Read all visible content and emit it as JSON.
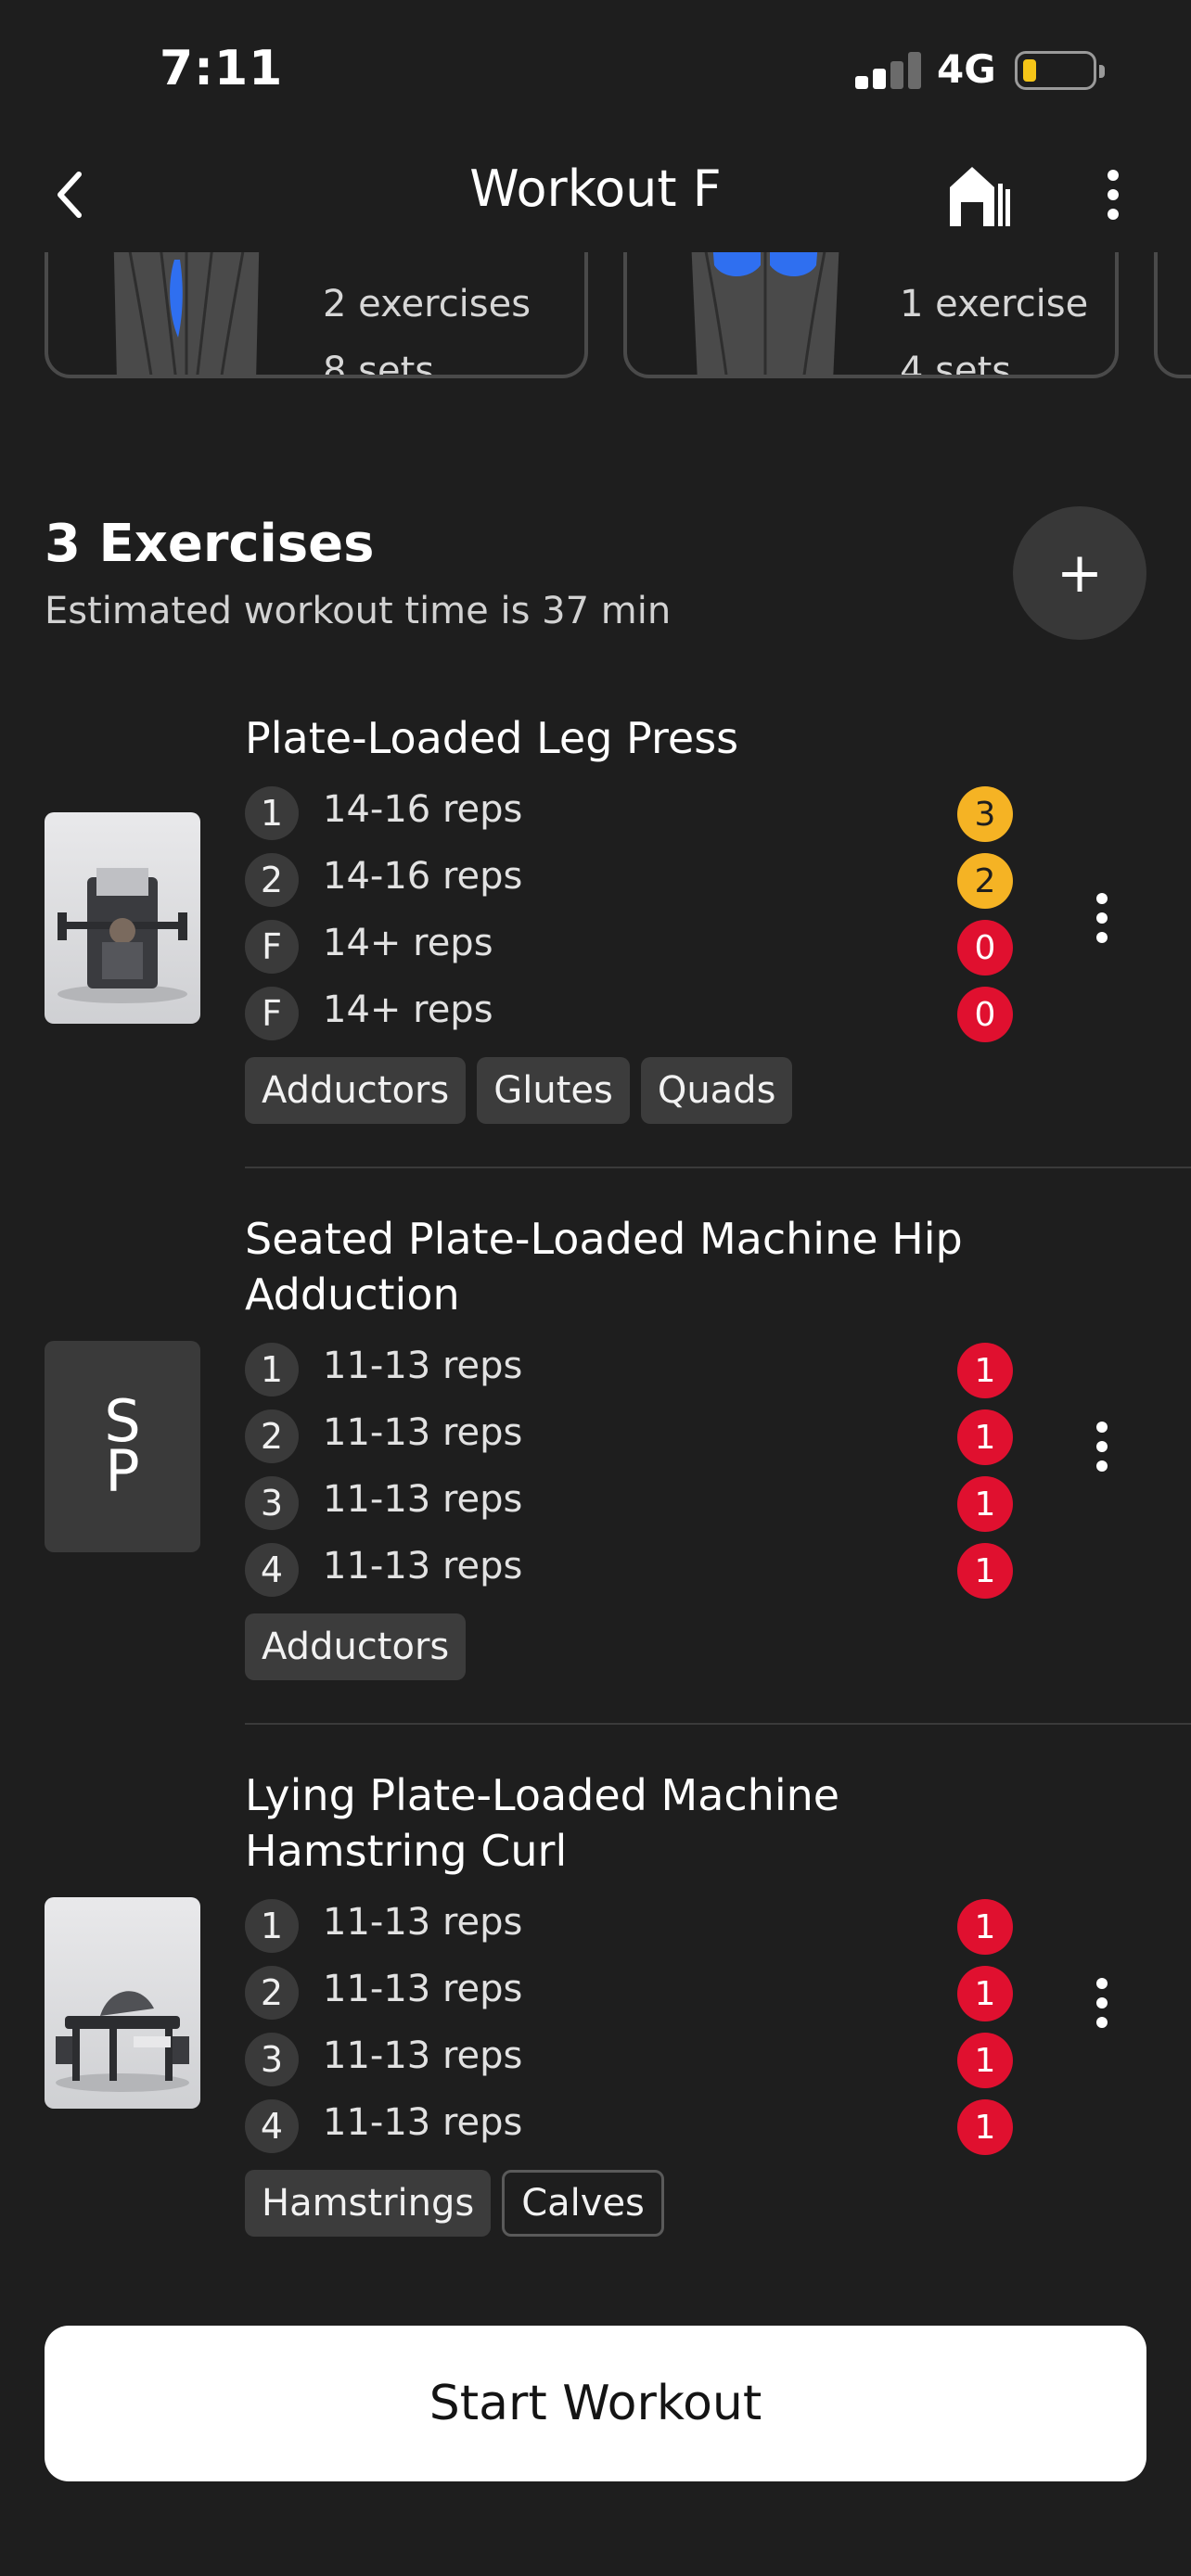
{
  "status_bar": {
    "time": "7:11",
    "network": "4G"
  },
  "header": {
    "title": "Workout F"
  },
  "muscle_cards": [
    {
      "line1": "2 exercises",
      "line2": "8 sets"
    },
    {
      "line1": "1 exercise",
      "line2": "4 sets"
    }
  ],
  "section": {
    "title": "3 Exercises",
    "subtitle": "Estimated workout time is 37 min"
  },
  "exercises": [
    {
      "name": "Plate-Loaded Leg Press",
      "sets": [
        {
          "label": "1",
          "reps": "14-16 reps",
          "rir": "3",
          "rir_color": "yellow"
        },
        {
          "label": "2",
          "reps": "14-16 reps",
          "rir": "2",
          "rir_color": "yellow"
        },
        {
          "label": "F",
          "reps": "14+ reps",
          "rir": "0",
          "rir_color": "red"
        },
        {
          "label": "F",
          "reps": "14+ reps",
          "rir": "0",
          "rir_color": "red"
        }
      ],
      "tags": [
        "Adductors",
        "Glutes",
        "Quads"
      ]
    },
    {
      "name": "Seated Plate-Loaded Machine Hip Adduction",
      "logo_letters": [
        "S",
        "P"
      ],
      "sets": [
        {
          "label": "1",
          "reps": "11-13 reps",
          "rir": "1",
          "rir_color": "red"
        },
        {
          "label": "2",
          "reps": "11-13 reps",
          "rir": "1",
          "rir_color": "red"
        },
        {
          "label": "3",
          "reps": "11-13 reps",
          "rir": "1",
          "rir_color": "red"
        },
        {
          "label": "4",
          "reps": "11-13 reps",
          "rir": "1",
          "rir_color": "red"
        }
      ],
      "tags": [
        "Adductors"
      ]
    },
    {
      "name": "Lying Plate-Loaded Machine Hamstring Curl",
      "sets": [
        {
          "label": "1",
          "reps": "11-13 reps",
          "rir": "1",
          "rir_color": "red"
        },
        {
          "label": "2",
          "reps": "11-13 reps",
          "rir": "1",
          "rir_color": "red"
        },
        {
          "label": "3",
          "reps": "11-13 reps",
          "rir": "1",
          "rir_color": "red"
        },
        {
          "label": "4",
          "reps": "11-13 reps",
          "rir": "1",
          "rir_color": "red"
        }
      ],
      "tags": [
        "Hamstrings",
        "Calves"
      ]
    }
  ],
  "footer": {
    "start_label": "Start Workout"
  },
  "colors": {
    "background": "#1e1e1e",
    "yellow": "#f5b324",
    "red": "#e0102f",
    "muscle_blue": "#2f6ff0"
  },
  "icons": {
    "back": "chevron-left-icon",
    "gym": "gym-building-icon",
    "more": "more-vertical-icon",
    "add": "plus-icon"
  }
}
